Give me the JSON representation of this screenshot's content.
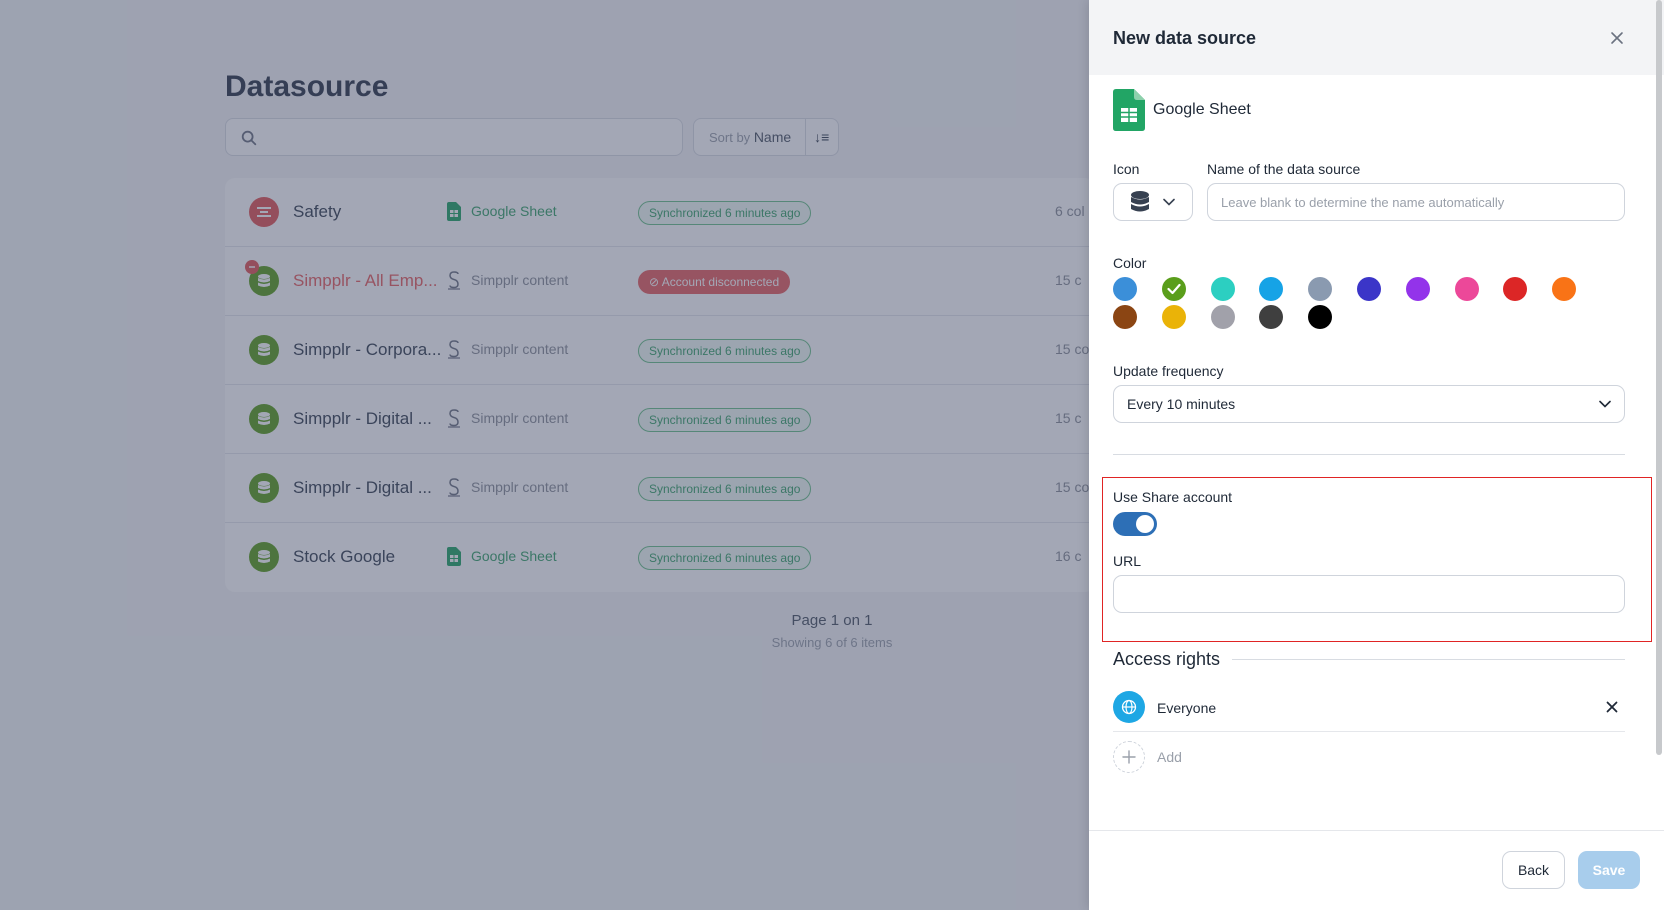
{
  "background": {
    "title": "Datasource",
    "sort": {
      "prefix": "Sort by",
      "value": "Name"
    },
    "rows": [
      {
        "name": "Safety",
        "source": "Google Sheet",
        "status": "Synchronized 6 minutes ago",
        "cols": "6 col"
      },
      {
        "name": "Simpplr - All Emp...",
        "source": "Simpplr content",
        "status": "Account disconnected",
        "cols": "15 c"
      },
      {
        "name": "Simpplr - Corpora...",
        "source": "Simpplr content",
        "status": "Synchronized 6 minutes ago",
        "cols": "15 co"
      },
      {
        "name": "Simpplr - Digital ...",
        "source": "Simpplr content",
        "status": "Synchronized 6 minutes ago",
        "cols": "15 c"
      },
      {
        "name": "Simpplr - Digital ...",
        "source": "Simpplr content",
        "status": "Synchronized 6 minutes ago",
        "cols": "15 col"
      },
      {
        "name": "Stock Google",
        "source": "Google Sheet",
        "status": "Synchronized 6 minutes ago",
        "cols": "16 c"
      }
    ],
    "pagination": {
      "page": "Page 1 on 1",
      "showing": "Showing 6 of 6 items"
    }
  },
  "drawer": {
    "title": "New data source",
    "source_type": "Google Sheet",
    "icon_label": "Icon",
    "name_label": "Name of the data source",
    "name_placeholder": "Leave blank to determine the name automatically",
    "color_label": "Color",
    "colors": [
      "#3b8fd9",
      "#5a9e1b",
      "#2ccfc1",
      "#16a3e6",
      "#8a9ab0",
      "#3b35c8",
      "#9333ea",
      "#ec4899",
      "#dc2626",
      "#f97316",
      "#8b4513",
      "#eab308",
      "#a1a1aa",
      "#3f3f3f",
      "#000000"
    ],
    "selected_color": "#5a9e1b",
    "frequency_label": "Update frequency",
    "frequency_value": "Every 10 minutes",
    "share_label": "Use Share account",
    "share_enabled": true,
    "url_label": "URL",
    "url_value": "",
    "access_title": "Access rights",
    "access_entries": [
      {
        "label": "Everyone",
        "icon": "globe-icon"
      }
    ],
    "add_label": "Add",
    "back_label": "Back",
    "save_label": "Save"
  }
}
